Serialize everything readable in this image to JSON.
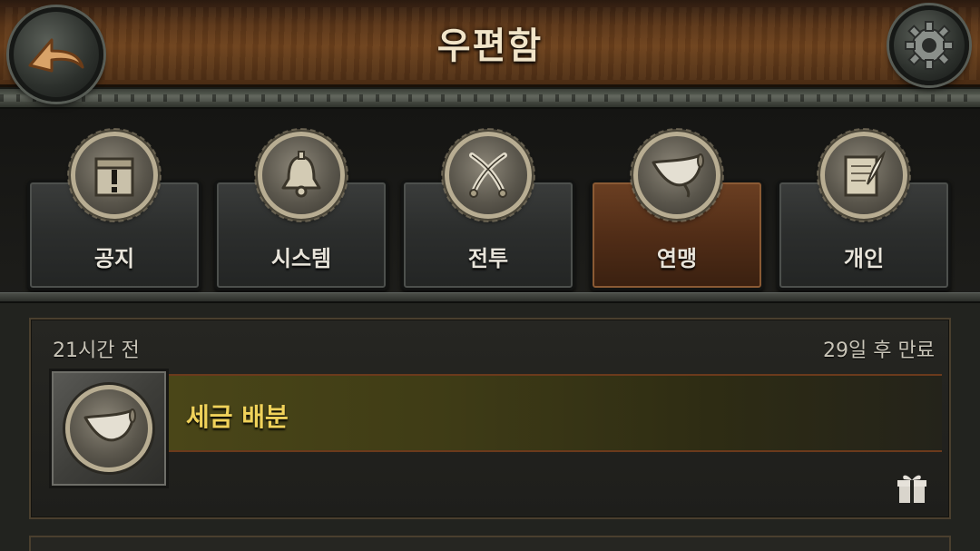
{
  "header": {
    "title": "우편함"
  },
  "tabs": [
    {
      "label": "공지",
      "icon": "notice-chest-icon",
      "active": false
    },
    {
      "label": "시스템",
      "icon": "bell-icon",
      "active": false
    },
    {
      "label": "전투",
      "icon": "crossed-swords-icon",
      "active": false
    },
    {
      "label": "연맹",
      "icon": "horn-icon",
      "active": true
    },
    {
      "label": "개인",
      "icon": "letter-quill-icon",
      "active": false
    }
  ],
  "mail": {
    "time": "21시간 전",
    "expire": "29일 후 만료",
    "subject": "세금 배분",
    "thumb_icon": "horn-icon",
    "attachment_icon": "gift-icon"
  },
  "colors": {
    "active_tab": "#6b3f22",
    "subject_text": "#f0d25a",
    "header_wood": "#6b401c"
  }
}
